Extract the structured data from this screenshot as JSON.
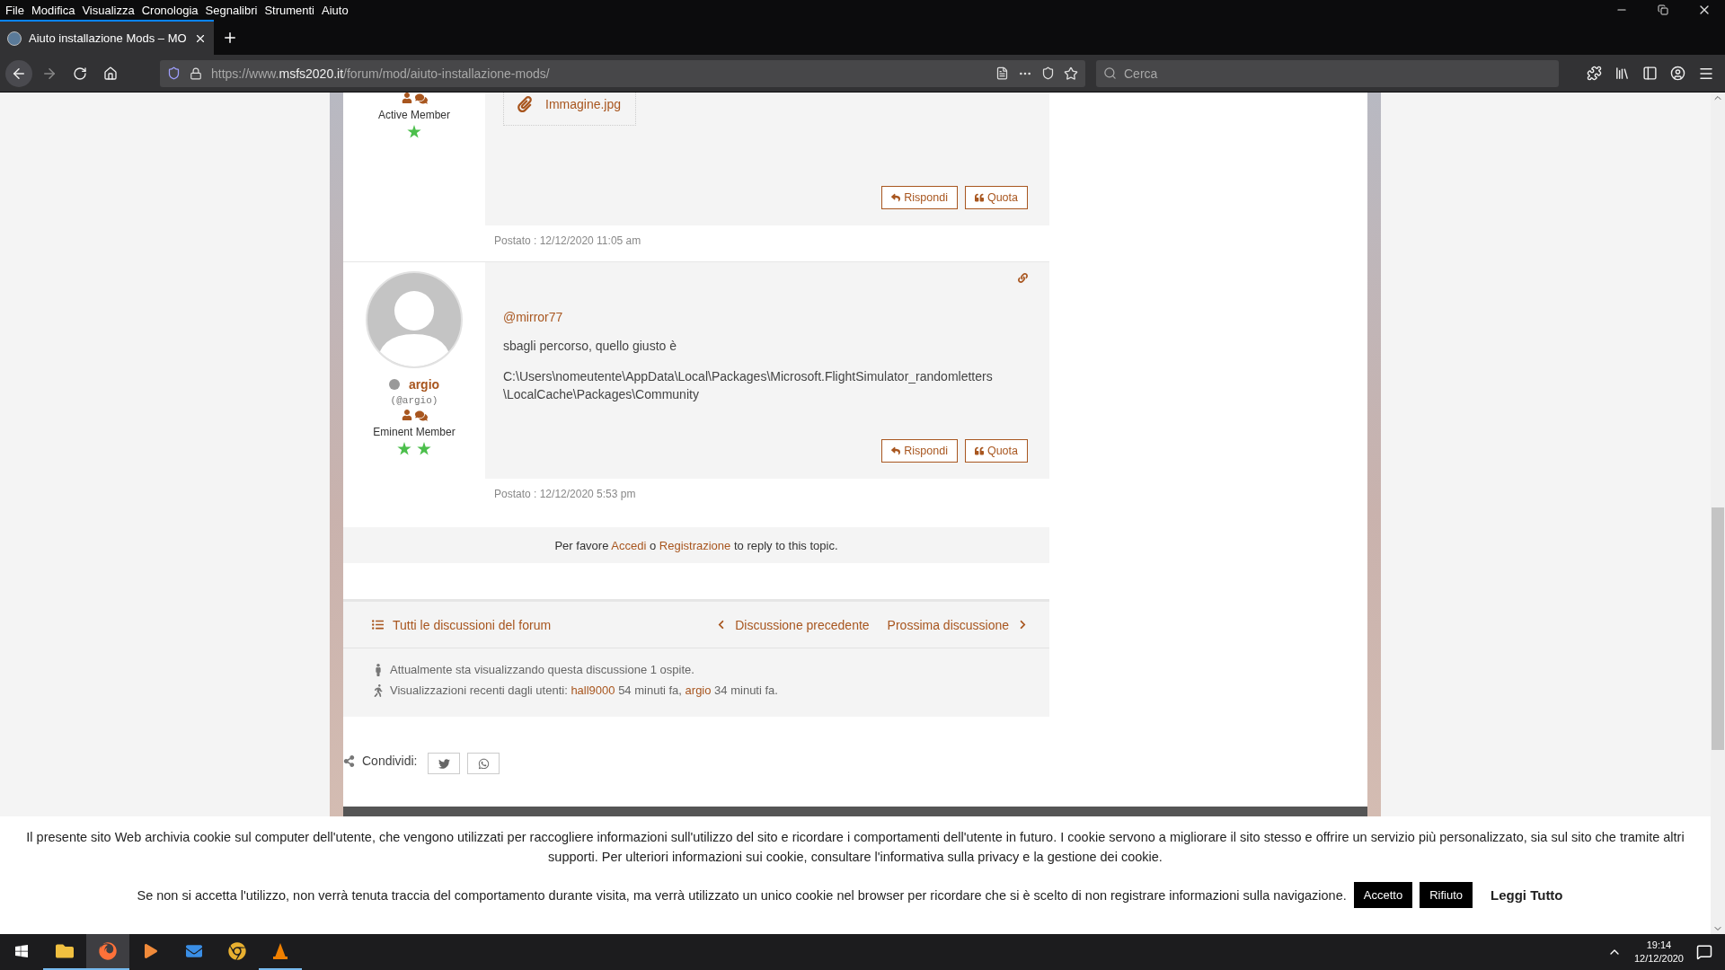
{
  "browser": {
    "menu": [
      "File",
      "Modifica",
      "Visualizza",
      "Cronologia",
      "Segnalibri",
      "Strumenti",
      "Aiuto"
    ],
    "tab": {
      "title": "Aiuto installazione Mods – MO",
      "selected": true
    },
    "url": {
      "prefix": "https://www.",
      "domain": "msfs2020.it",
      "path": "/forum/mod/aiuto-installazione-mods/"
    },
    "search": {
      "placeholder": "Cerca"
    }
  },
  "posts": [
    {
      "rank": "Active Member",
      "rank_badges": [
        {
          "kind": "star"
        }
      ],
      "attachment": "Immagine.jpg",
      "actions": [
        {
          "kind": "reply",
          "label": "Rispondi"
        },
        {
          "kind": "quote",
          "label": "Quota"
        }
      ],
      "posted": "Postato : 12/12/2020 11:05 am"
    },
    {
      "author": {
        "name": "argio",
        "handle": "(@argio)",
        "online": false
      },
      "rank": "Eminent Member",
      "rank_badges": [
        {
          "kind": "star"
        },
        {
          "kind": "star"
        }
      ],
      "mention": "@mirror77",
      "paragraphs": [
        [
          "sbagli percorso, quello giusto è"
        ],
        [
          "C:\\Users\\nomeutente\\AppData\\Local\\Packages\\Microsoft.FlightSimulator_randomletters",
          "\\LocalCache\\Packages\\Community"
        ]
      ],
      "actions": [
        {
          "kind": "reply",
          "label": "Rispondi"
        },
        {
          "kind": "quote",
          "label": "Quota"
        }
      ],
      "posted": "Postato : 12/12/2020 5:53 pm"
    }
  ],
  "login_prompt": [
    {
      "kind": "text",
      "text": "Per favore "
    },
    {
      "kind": "link",
      "text": "Accedi"
    },
    {
      "kind": "text",
      "text": " o "
    },
    {
      "kind": "link",
      "text": "Registrazione"
    },
    {
      "kind": "text",
      "text": " to reply to this topic."
    }
  ],
  "topic_nav": {
    "all": "Tutti le discussioni del forum",
    "previous": "Discussione precedente",
    "next": "Prossima discussione"
  },
  "viewers": {
    "current": "Attualmente sta visualizzando questa discussione 1 ospite.",
    "recent": [
      {
        "kind": "text",
        "text": "Visualizzazioni recenti dagli utenti: "
      },
      {
        "kind": "link",
        "text": "hall9000"
      },
      {
        "kind": "text",
        "text": " 54 minuti fa, "
      },
      {
        "kind": "link",
        "text": "argio"
      },
      {
        "kind": "text",
        "text": " 34 minuti fa."
      }
    ]
  },
  "share": {
    "label": "Condividi:",
    "buttons": [
      {
        "kind": "twitter"
      },
      {
        "kind": "whatsapp"
      }
    ]
  },
  "cookie_banner": {
    "text": "Il presente sito Web archivia cookie sul computer dell'utente, che vengono utilizzati per raccogliere informazioni sull'utilizzo del sito e ricordare i comportamenti dell'utente in futuro. I cookie servono a migliorare il sito stesso e offrire un servizio più personalizzato, sia sul sito che tramite altri supporti. Per ulteriori informazioni sui cookie, consultare l'informativa sulla privacy e la gestione dei cookie.",
    "notice": "Se non si accetta l'utilizzo, non verrà tenuta traccia del comportamento durante visita, ma verrà utilizzato un unico cookie nel browser per ricordare che si è scelto di non registrare informazioni sulla navigazione.",
    "buttons": [
      {
        "kind": "solid",
        "label": "Accetto"
      },
      {
        "kind": "solid",
        "label": "Rifiuto"
      },
      {
        "kind": "plain",
        "label": "Leggi Tutto"
      }
    ]
  },
  "taskbar": {
    "apps": [
      {
        "kind": "folder",
        "running": true,
        "selected": false
      },
      {
        "kind": "browser",
        "running": true,
        "selected": true
      },
      {
        "kind": "player",
        "running": false,
        "selected": false
      },
      {
        "kind": "mail",
        "running": false,
        "selected": false
      },
      {
        "kind": "chrome",
        "running": false,
        "selected": false
      },
      {
        "kind": "cone",
        "running": true,
        "selected": false
      }
    ],
    "time": "19:14",
    "date": "12/12/2020"
  }
}
